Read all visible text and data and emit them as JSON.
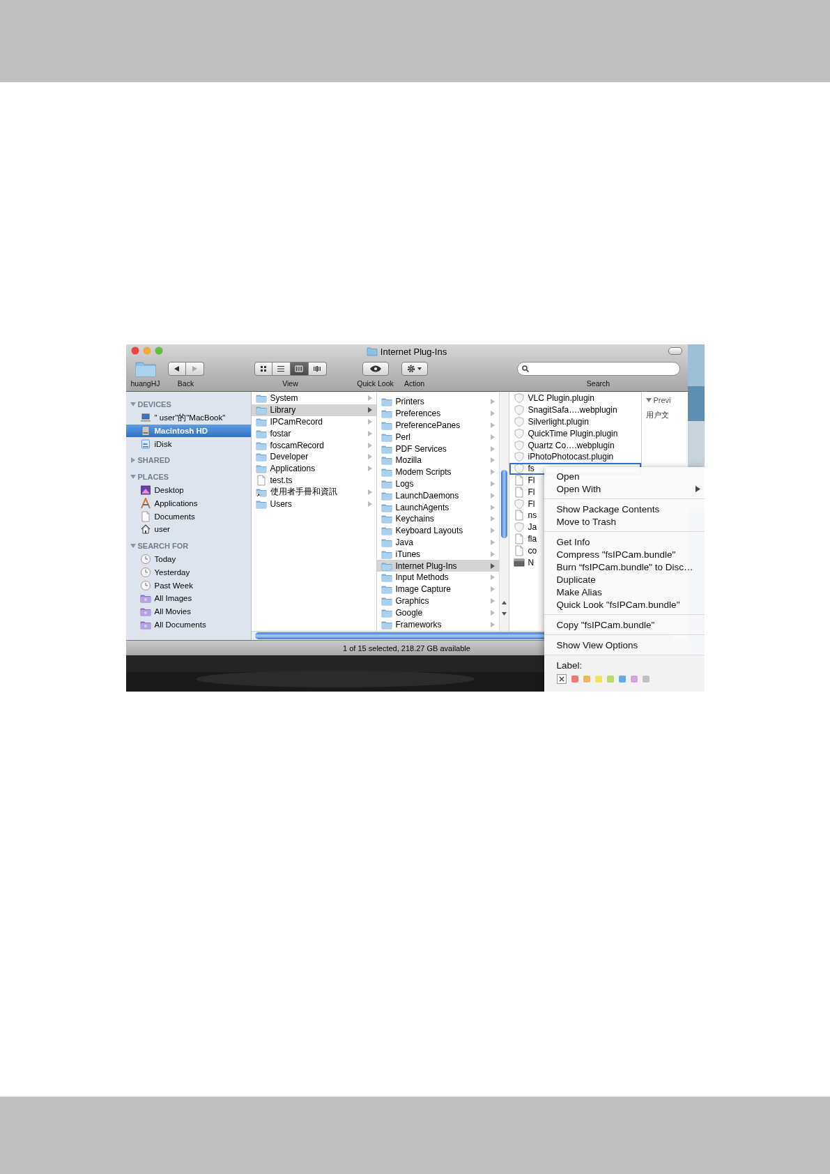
{
  "window": {
    "title": "Internet Plug-Ins"
  },
  "toolbar": [
    {
      "kind": "folder",
      "label": "huangHJ"
    },
    {
      "kind": "nav",
      "label": "Back"
    },
    {
      "kind": "view",
      "label": "View",
      "modes": [
        {
          "kind": "icon",
          "selected": false
        },
        {
          "kind": "list",
          "selected": false
        },
        {
          "kind": "columns",
          "selected": true
        },
        {
          "kind": "coverflow",
          "selected": false
        }
      ]
    },
    {
      "kind": "quicklook",
      "label": "Quick Look"
    },
    {
      "kind": "action",
      "label": "Action"
    },
    {
      "kind": "search",
      "label": "Search"
    }
  ],
  "sidebar": {
    "sections": [
      {
        "title": "DEVICES",
        "expanded": true,
        "items": [
          {
            "label": "\" user\"的\"MacBook\"",
            "kind": "laptop",
            "selected": false
          },
          {
            "label": "Macintosh HD",
            "kind": "drive",
            "selected": true
          },
          {
            "label": "iDisk",
            "kind": "idisk",
            "selected": false
          }
        ]
      },
      {
        "title": "SHARED",
        "expanded": false
      },
      {
        "title": "PLACES",
        "expanded": true,
        "items": [
          {
            "label": "Desktop",
            "kind": "desktop",
            "selected": false
          },
          {
            "label": "Applications",
            "kind": "applications",
            "selected": false
          },
          {
            "label": "Documents",
            "kind": "document",
            "selected": false
          },
          {
            "label": "user",
            "kind": "home",
            "selected": false
          }
        ]
      },
      {
        "title": "SEARCH FOR",
        "expanded": true,
        "items": [
          {
            "label": "Today",
            "kind": "clock",
            "selected": false
          },
          {
            "label": "Yesterday",
            "kind": "clock",
            "selected": false
          },
          {
            "label": "Past Week",
            "kind": "clock",
            "selected": false
          },
          {
            "label": "All Images",
            "kind": "smart-folder",
            "selected": false
          },
          {
            "label": "All Movies",
            "kind": "smart-folder",
            "selected": false
          },
          {
            "label": "All Documents",
            "kind": "smart-folder",
            "selected": false
          }
        ]
      }
    ]
  },
  "columns": [
    {
      "items": [
        {
          "label": "System",
          "kind": "folder",
          "has_children": true,
          "selected": false
        },
        {
          "label": "Library",
          "kind": "folder",
          "has_children": true,
          "selected": true
        },
        {
          "label": "IPCamRecord",
          "kind": "folder",
          "has_children": true,
          "selected": false
        },
        {
          "label": "fostar",
          "kind": "folder",
          "has_children": true,
          "selected": false
        },
        {
          "label": "foscamRecord",
          "kind": "folder",
          "has_children": true,
          "selected": false
        },
        {
          "label": "Developer",
          "kind": "folder",
          "has_children": true,
          "selected": false
        },
        {
          "label": "Applications",
          "kind": "folder",
          "has_children": true,
          "selected": false
        },
        {
          "label": "test.ts",
          "kind": "document",
          "has_children": false,
          "selected": false
        },
        {
          "label": "使用者手冊和資訊",
          "kind": "alias-folder",
          "has_children": true,
          "selected": false
        },
        {
          "label": "Users",
          "kind": "folder",
          "has_children": true,
          "selected": false
        }
      ]
    },
    {
      "items": [
        {
          "label": "Printers",
          "kind": "folder",
          "has_children": true,
          "selected": false
        },
        {
          "label": "Preferences",
          "kind": "folder",
          "has_children": true,
          "selected": false
        },
        {
          "label": "PreferencePanes",
          "kind": "folder",
          "has_children": true,
          "selected": false
        },
        {
          "label": "Perl",
          "kind": "folder",
          "has_children": true,
          "selected": false
        },
        {
          "label": "PDF Services",
          "kind": "folder",
          "has_children": true,
          "selected": false
        },
        {
          "label": "Mozilla",
          "kind": "folder",
          "has_children": true,
          "selected": false
        },
        {
          "label": "Modem Scripts",
          "kind": "folder",
          "has_children": true,
          "selected": false
        },
        {
          "label": "Logs",
          "kind": "folder",
          "has_children": true,
          "selected": false
        },
        {
          "label": "LaunchDaemons",
          "kind": "folder",
          "has_children": true,
          "selected": false
        },
        {
          "label": "LaunchAgents",
          "kind": "folder",
          "has_children": true,
          "selected": false
        },
        {
          "label": "Keychains",
          "kind": "folder",
          "has_children": true,
          "selected": false
        },
        {
          "label": "Keyboard Layouts",
          "kind": "folder",
          "has_children": true,
          "selected": false
        },
        {
          "label": "Java",
          "kind": "folder",
          "has_children": true,
          "selected": false
        },
        {
          "label": "iTunes",
          "kind": "folder",
          "has_children": true,
          "selected": false
        },
        {
          "label": "Internet Plug-Ins",
          "kind": "folder",
          "has_children": true,
          "selected": true
        },
        {
          "label": "Input Methods",
          "kind": "folder",
          "has_children": true,
          "selected": false
        },
        {
          "label": "Image Capture",
          "kind": "folder",
          "has_children": true,
          "selected": false
        },
        {
          "label": "Graphics",
          "kind": "folder",
          "has_children": true,
          "selected": false
        },
        {
          "label": "Google",
          "kind": "folder",
          "has_children": true,
          "selected": false
        },
        {
          "label": "Frameworks",
          "kind": "folder",
          "has_children": true,
          "selected": false
        }
      ]
    },
    {
      "items": [
        {
          "label": "VLC Plugin.plugin",
          "kind": "plugin",
          "has_children": false,
          "selected": false
        },
        {
          "label": "SnagitSafa….webplugin",
          "kind": "plugin",
          "has_children": false,
          "selected": false
        },
        {
          "label": "Silverlight.plugin",
          "kind": "plugin",
          "has_children": false,
          "selected": false
        },
        {
          "label": "QuickTime Plugin.plugin",
          "kind": "plugin",
          "has_children": false,
          "selected": false
        },
        {
          "label": "Quartz Co….webplugin",
          "kind": "plugin",
          "has_children": false,
          "selected": false
        },
        {
          "label": "iPhotoPhotocast.plugin",
          "kind": "plugin",
          "has_children": false,
          "selected": false
        },
        {
          "label": "fs",
          "kind": "plugin",
          "has_children": false,
          "selected": true
        },
        {
          "label": "Fl",
          "kind": "document",
          "has_children": false,
          "selected": false
        },
        {
          "label": "Fl",
          "kind": "document",
          "has_children": false,
          "selected": false
        },
        {
          "label": "Fl",
          "kind": "plugin",
          "has_children": false,
          "selected": false
        },
        {
          "label": "ns",
          "kind": "document",
          "has_children": false,
          "selected": false
        },
        {
          "label": "Ja",
          "kind": "plugin",
          "has_children": false,
          "selected": false
        },
        {
          "label": "fla",
          "kind": "document",
          "has_children": false,
          "selected": false
        },
        {
          "label": "co",
          "kind": "document",
          "has_children": false,
          "selected": false
        },
        {
          "label": "N",
          "kind": "disk-image",
          "has_children": false,
          "selected": false
        }
      ]
    }
  ],
  "preview": {
    "title": "Previ",
    "expanded": true,
    "caption": "用户文"
  },
  "status_bar": "1 of 15 selected, 218.27 GB available",
  "context_menu": {
    "items": [
      {
        "kind": "item",
        "label": "Open"
      },
      {
        "kind": "submenu",
        "label": "Open With"
      },
      {
        "kind": "separator"
      },
      {
        "kind": "item",
        "label": "Show Package Contents"
      },
      {
        "kind": "item",
        "label": "Move to Trash"
      },
      {
        "kind": "separator"
      },
      {
        "kind": "item",
        "label": "Get Info"
      },
      {
        "kind": "item",
        "label": "Compress \"fsIPCam.bundle\""
      },
      {
        "kind": "item",
        "label": "Burn “fsIPCam.bundle\" to Disc…"
      },
      {
        "kind": "item",
        "label": "Duplicate"
      },
      {
        "kind": "item",
        "label": "Make Alias"
      },
      {
        "kind": "item",
        "label": "Quick Look \"fsIPCam.bundle\""
      },
      {
        "kind": "separator"
      },
      {
        "kind": "item",
        "label": "Copy \"fsIPCam.bundle\""
      },
      {
        "kind": "separator"
      },
      {
        "kind": "item",
        "label": "Show View Options"
      },
      {
        "kind": "separator"
      },
      {
        "kind": "header",
        "label": "Label:"
      },
      {
        "kind": "labels",
        "swatches": [
          {
            "kind": "none",
            "selected": true
          },
          {
            "kind": "color",
            "color": "#f07a78",
            "selected": false
          },
          {
            "kind": "color",
            "color": "#f5b55a",
            "selected": false
          },
          {
            "kind": "color",
            "color": "#f2e35e",
            "selected": false
          },
          {
            "kind": "color",
            "color": "#b3dc6a",
            "selected": false
          },
          {
            "kind": "color",
            "color": "#62aaf0",
            "selected": false
          },
          {
            "kind": "color",
            "color": "#d2a3e0",
            "selected": false
          },
          {
            "kind": "color",
            "color": "#c2c2c2",
            "selected": false
          }
        ]
      }
    ]
  }
}
